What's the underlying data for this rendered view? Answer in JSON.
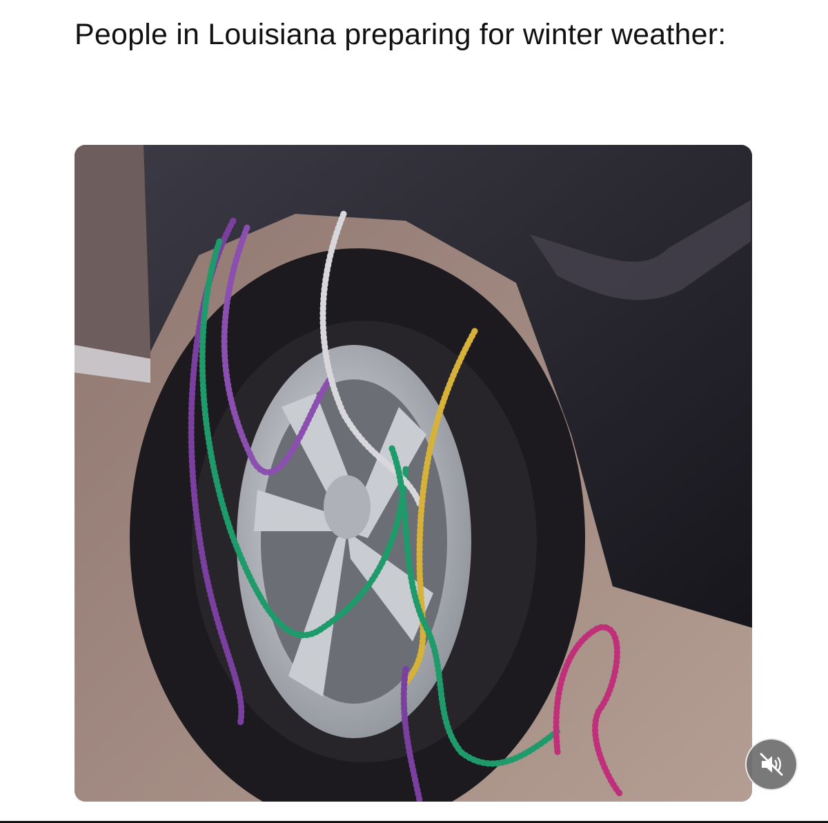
{
  "post": {
    "text": "People in Louisiana preparing for winter weather:"
  },
  "media": {
    "description_icon": "photo",
    "colors": {
      "truck_body": "#2b2a33",
      "tire": "#1c1a1e",
      "rim": "#b9bcc2",
      "floor": "#a08a80",
      "bead_purple": "#7b3fa0",
      "bead_green": "#1f9a6a",
      "bead_gold": "#d6b23a",
      "bead_silver": "#d8d8dc",
      "bead_pink": "#c0307a"
    }
  },
  "controls": {
    "mute_icon": "speaker-muted-icon"
  }
}
